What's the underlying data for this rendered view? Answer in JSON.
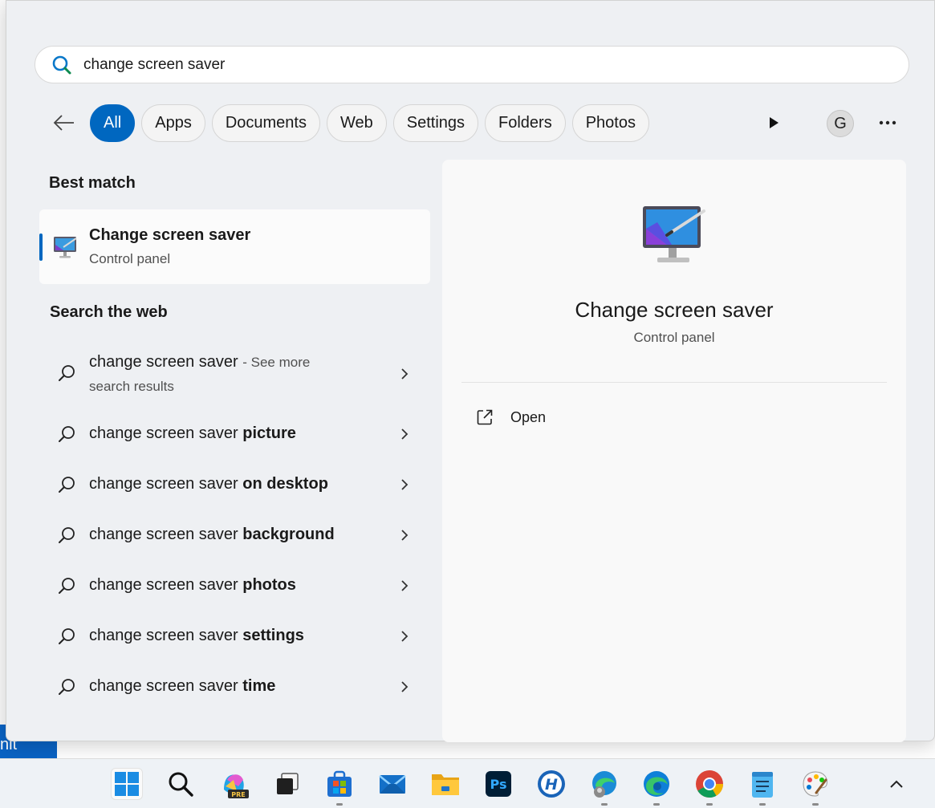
{
  "search": {
    "query": "change screen saver"
  },
  "filters": {
    "chips": [
      "All",
      "Apps",
      "Documents",
      "Web",
      "Settings",
      "Folders",
      "Photos"
    ],
    "active": "All",
    "avatar_initial": "G",
    "more_label": "···"
  },
  "best_match": {
    "heading": "Best match",
    "title": "Change screen saver",
    "subtitle": "Control panel"
  },
  "web": {
    "heading": "Search the web",
    "items": [
      {
        "prefix": "change screen saver",
        "suffix": "",
        "extra": "- See more",
        "line2": "search results"
      },
      {
        "prefix": "change screen saver",
        "suffix": "picture"
      },
      {
        "prefix": "change screen saver",
        "suffix": "on desktop"
      },
      {
        "prefix": "change screen saver",
        "suffix": "background"
      },
      {
        "prefix": "change screen saver",
        "suffix": "photos"
      },
      {
        "prefix": "change screen saver",
        "suffix": "settings"
      },
      {
        "prefix": "change screen saver",
        "suffix": "time"
      }
    ]
  },
  "detail": {
    "title": "Change screen saver",
    "subtitle": "Control panel",
    "actions": [
      {
        "label": "Open",
        "icon": "open-external-icon"
      }
    ]
  },
  "background": {
    "tab_text": "nit"
  },
  "taskbar": {
    "icons": [
      "start-icon",
      "search-icon",
      "copilot-icon",
      "task-view-icon",
      "microsoft-store-icon",
      "mail-icon",
      "file-explorer-icon",
      "photoshop-icon",
      "h-app-icon",
      "edge-profile-icon",
      "edge-icon",
      "chrome-icon",
      "notepad-icon",
      "paint-icon"
    ],
    "photoshop_label": "Ps",
    "copilot_badge": "PRE",
    "h_label": "H"
  },
  "colors": {
    "accent": "#0067c0",
    "panel_bg": "#eef0f3",
    "detail_bg": "#f9f9f9"
  }
}
